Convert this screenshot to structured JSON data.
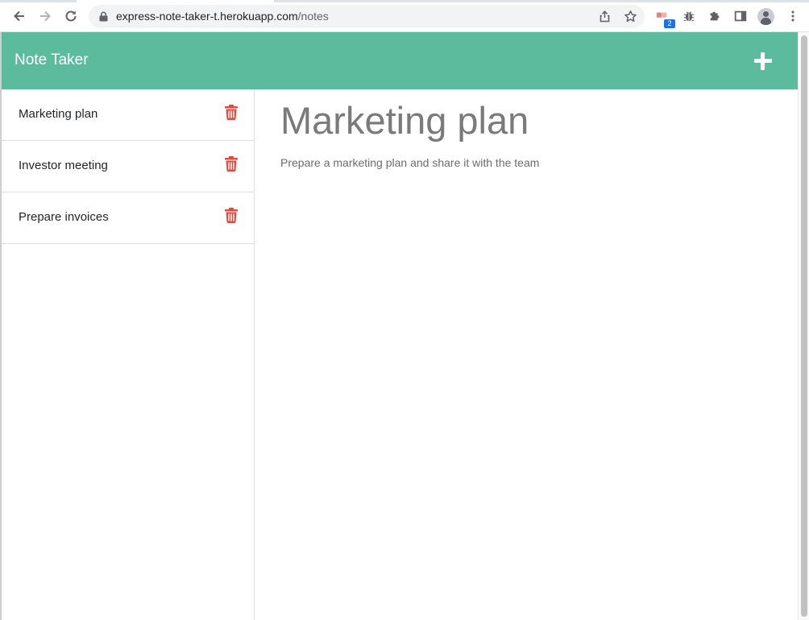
{
  "browser": {
    "url_host": "express-note-taker-t.herokuapp.com",
    "url_path": "/notes",
    "extension_badge": "2"
  },
  "app": {
    "title": "Note Taker",
    "header_color": "#5cba9d",
    "delete_icon_color": "#dc4c3f"
  },
  "notes": [
    {
      "title": "Marketing plan"
    },
    {
      "title": "Investor meeting"
    },
    {
      "title": "Prepare invoices"
    }
  ],
  "active_note": {
    "title": "Marketing plan",
    "text": "Prepare a marketing plan and share it with the team"
  }
}
